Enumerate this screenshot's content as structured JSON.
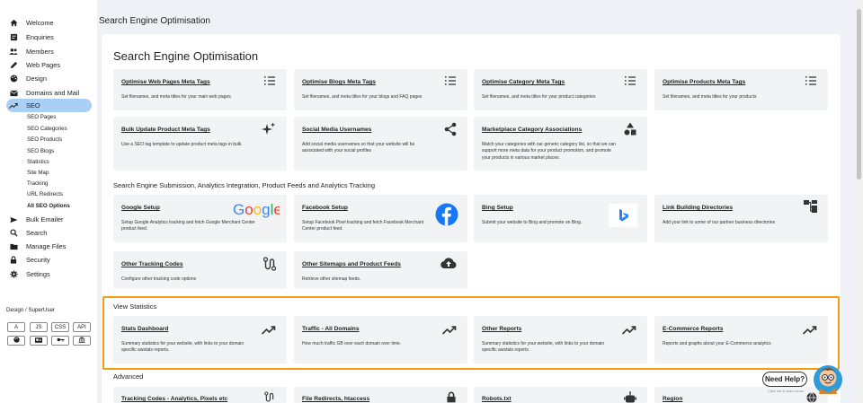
{
  "sidebar": {
    "items": [
      {
        "label": "Welcome",
        "icon": "home-icon"
      },
      {
        "label": "Enquiries",
        "icon": "enquiries-icon"
      },
      {
        "label": "Members",
        "icon": "members-icon"
      },
      {
        "label": "Web Pages",
        "icon": "pencil-icon"
      },
      {
        "label": "Design",
        "icon": "palette-icon"
      },
      {
        "label": "Domains and Mail",
        "icon": "mail-icon"
      },
      {
        "label": "SEO",
        "icon": "trend-icon",
        "active": true
      },
      {
        "label": "Bulk Emailer",
        "icon": "send-icon"
      },
      {
        "label": "Search",
        "icon": "search-icon"
      },
      {
        "label": "Manage Files",
        "icon": "folder-icon"
      },
      {
        "label": "Security",
        "icon": "lock-icon"
      },
      {
        "label": "Settings",
        "icon": "gear-icon"
      }
    ],
    "seo_sub": [
      "SEO Pages",
      "SEO Categories",
      "SEO Products",
      "SEO Blogs",
      "Statistics",
      "Site Map",
      "Tracking",
      "URL Redirects",
      "All SEO Options"
    ],
    "design_label": "Design / SuperUser",
    "tools": [
      "A",
      "JS",
      "CSS",
      "API"
    ]
  },
  "page_title": "Search Engine Optimisation",
  "panel_title": "Search Engine Optimisation",
  "sections": {
    "submission": "Search Engine Submission, Analytics Integration, Product Feeds and Analytics Tracking",
    "statistics": "View Statistics",
    "advanced": "Advanced"
  },
  "cards": [
    {
      "title": "Optimise Web Pages Meta Tags",
      "desc": "Set filenames, and meta titles for your main web pages",
      "icon": "list-icon"
    },
    {
      "title": "Optimise Blogs Meta Tags",
      "desc": "Set filenames, and meta titles for your blogs and FAQ pages",
      "icon": "list-icon"
    },
    {
      "title": "Optimise Category Meta Tags",
      "desc": "Set filenames, and meta titles for your product categories",
      "icon": "list-icon"
    },
    {
      "title": "Optimise Products Meta Tags",
      "desc": "Set filenames, and meta titles for your products",
      "icon": "list-icon"
    },
    {
      "title": "Bulk Update Product Meta Tags",
      "desc": "Use a SEO tag template to update product meta tags in bulk.",
      "icon": "sparkle-icon"
    },
    {
      "title": "Social Media Usernames",
      "desc": "Add social media usernames so that your website will be associated with your social profiles",
      "icon": "share-icon"
    },
    {
      "title": "Marketplace Category Associations",
      "desc": "Match your categories with our generic category list, so that we can support more meta data for your product promotion, and promote your products in various market places.",
      "icon": "shapes-icon"
    },
    {
      "title": "Google Setup",
      "desc": "Setup Google Analytics tracking and fetch Google Merchant Center product feed.",
      "icon": "google-logo",
      "logo_text": "Google"
    },
    {
      "title": "Facebook Setup",
      "desc": "Setup Facebook Pixel tracking and fetch Facebook Merchant Center product feed.",
      "icon": "facebook-logo"
    },
    {
      "title": "Bing Setup",
      "desc": "Submit your website to Bing and promote on Bing.",
      "icon": "bing-logo"
    },
    {
      "title": "Link Building Directories",
      "desc": "Add your link to some of our partner business directories",
      "icon": "directory-icon"
    },
    {
      "title": "Other Tracking Codes",
      "desc": "Configure other tracking code options",
      "icon": "route-icon"
    },
    {
      "title": "Other Sitemaps and Product Feeds",
      "desc": "Retrieve other sitemap feeds.",
      "icon": "cloud-upload-icon"
    },
    {
      "title": "Stats Dashboard",
      "desc": "Summary statistics for your website, with links to your domain specific awstats reports.",
      "icon": "trend-icon"
    },
    {
      "title": "Traffic - All Domains",
      "desc": "How much traffic GB over each domain over time.",
      "icon": "trend-icon"
    },
    {
      "title": "Other Reports",
      "desc": "Summary statistics for your website, with links to your domain specific awstats reports",
      "icon": "trend-icon"
    },
    {
      "title": "E-Commerce Reports",
      "desc": "Reports and graphs about your E-Commerce analytics",
      "icon": "trend-icon"
    },
    {
      "title": "Tracking Codes - Analytics, Pixels etc",
      "desc": "",
      "icon": "route-icon"
    },
    {
      "title": "File Redirects, htaccess",
      "desc": "",
      "icon": "lock-icon"
    },
    {
      "title": "Robots.txt",
      "desc": "",
      "icon": "robot-icon"
    },
    {
      "title": "Region",
      "desc": "",
      "icon": "globe-icon"
    }
  ],
  "help": {
    "label": "Need Help?",
    "sub": "Click me to learn more"
  },
  "colors": {
    "accent": "#a9cff5",
    "highlight": "#f39c12",
    "card_bg": "#f2f3f4",
    "panel_bg": "#ffffff",
    "page_bg": "#eef1f6"
  }
}
